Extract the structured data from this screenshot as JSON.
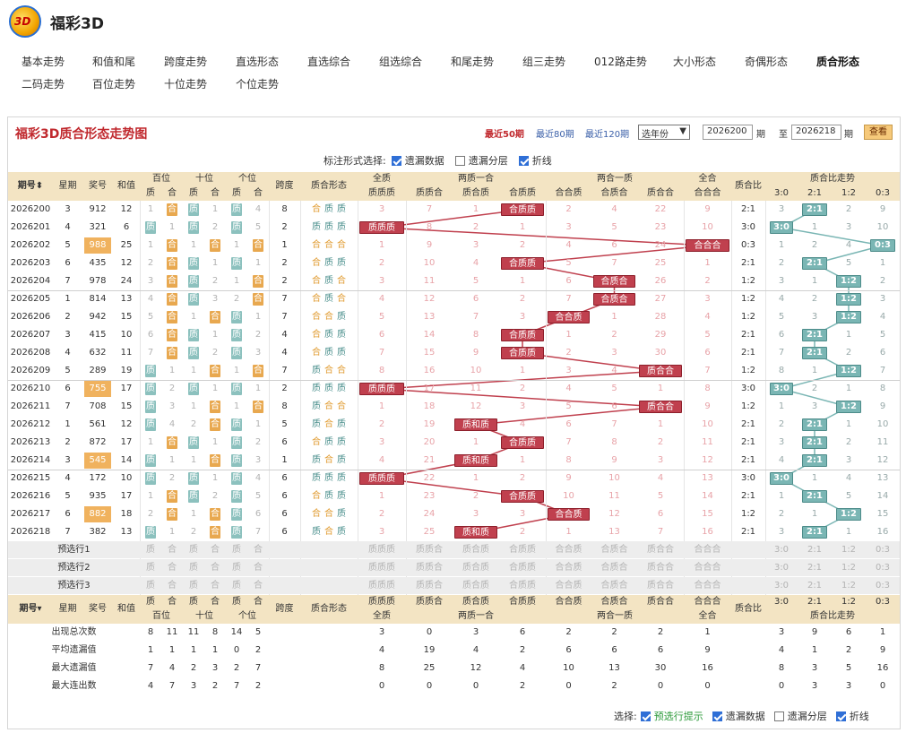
{
  "app": {
    "title": "福彩3D",
    "logo_text": "3D"
  },
  "nav": [
    "基本走势",
    "和值和尾",
    "跨度走势",
    "直选形态",
    "直选综合",
    "组选综合",
    "和尾走势",
    "组三走势",
    "012路走势",
    "大小形态",
    "奇偶形态",
    "质合形态",
    "二码走势",
    "百位走势",
    "十位走势",
    "个位走势"
  ],
  "nav_active": "质合形态",
  "panel": {
    "title": "福彩3D质合形态走势图",
    "ranges": [
      "最近50期",
      "最近80期",
      "最近120期"
    ],
    "year_select": "选年份",
    "from": "2026200",
    "to": "2026218",
    "period_unit": "期",
    "to_word": "至",
    "view_button": "查看",
    "mark_label": "标注形式选择:",
    "mark_opts": [
      {
        "label": "遗漏数据",
        "on": true
      },
      {
        "label": "遗漏分层",
        "on": false
      },
      {
        "label": "折线",
        "on": true
      }
    ]
  },
  "headers": {
    "period": "期号",
    "week": "星期",
    "number": "奖号",
    "sum": "和值",
    "pos": [
      "百位",
      "十位",
      "个位"
    ],
    "span": "跨度",
    "shape": "质合形态",
    "zh": [
      "质",
      "合"
    ],
    "groups": [
      "全质",
      "两质一合",
      "两合一质",
      "全合"
    ],
    "sub": [
      "质质质",
      "质质合",
      "质合质",
      "合质质",
      "合合质",
      "合质合",
      "质合合",
      "合合合"
    ],
    "ratio": "质合比",
    "trend": "质合比走势",
    "trend_cols": [
      "3:0",
      "2:1",
      "1:2",
      "0:3"
    ]
  },
  "rows": [
    {
      "p": "2026200",
      "w": "3",
      "n": "912",
      "s": "12",
      "hl": false,
      "pos": [
        "1",
        "合",
        "质",
        "1",
        "质",
        "4"
      ],
      "span": "8",
      "shape": "合质质",
      "sub": [
        "3",
        "7",
        "1",
        "合质质",
        "2",
        "4",
        "22",
        "9"
      ],
      "ratio": "2:1",
      "tr": [
        "3",
        "2:1",
        "2",
        "9"
      ]
    },
    {
      "p": "2026201",
      "w": "4",
      "n": "321",
      "s": "6",
      "hl": false,
      "pos": [
        "质",
        "1",
        "质",
        "2",
        "质",
        "5"
      ],
      "span": "2",
      "shape": "质质质",
      "sub": [
        "质质质",
        "8",
        "2",
        "1",
        "3",
        "5",
        "23",
        "10"
      ],
      "ratio": "3:0",
      "tr": [
        "3:0",
        "1",
        "3",
        "10"
      ]
    },
    {
      "p": "2026202",
      "w": "5",
      "n": "988",
      "s": "25",
      "hl": true,
      "pos": [
        "1",
        "合",
        "1",
        "合",
        "1",
        "合"
      ],
      "span": "1",
      "shape": "合合合",
      "sub": [
        "1",
        "9",
        "3",
        "2",
        "4",
        "6",
        "24",
        "合合合"
      ],
      "ratio": "0:3",
      "tr": [
        "1",
        "2",
        "4",
        "0:3"
      ]
    },
    {
      "p": "2026203",
      "w": "6",
      "n": "435",
      "s": "12",
      "hl": false,
      "pos": [
        "2",
        "合",
        "质",
        "1",
        "质",
        "1"
      ],
      "span": "2",
      "shape": "合质质",
      "sub": [
        "2",
        "10",
        "4",
        "合质质",
        "5",
        "7",
        "25",
        "1"
      ],
      "ratio": "2:1",
      "tr": [
        "2",
        "2:1",
        "5",
        "1"
      ]
    },
    {
      "p": "2026204",
      "w": "7",
      "n": "978",
      "s": "24",
      "hl": false,
      "pos": [
        "3",
        "合",
        "质",
        "2",
        "1",
        "合"
      ],
      "span": "2",
      "shape": "合质合",
      "sub": [
        "3",
        "11",
        "5",
        "1",
        "6",
        "合质合",
        "26",
        "2"
      ],
      "ratio": "1:2",
      "tr": [
        "3",
        "1",
        "1:2",
        "2"
      ]
    },
    {
      "p": "2026205",
      "w": "1",
      "n": "814",
      "s": "13",
      "hl": false,
      "pos": [
        "4",
        "合",
        "质",
        "3",
        "2",
        "合"
      ],
      "span": "7",
      "shape": "合质合",
      "sub": [
        "4",
        "12",
        "6",
        "2",
        "7",
        "合质合",
        "27",
        "3"
      ],
      "ratio": "1:2",
      "tr": [
        "4",
        "2",
        "1:2",
        "3"
      ]
    },
    {
      "p": "2026206",
      "w": "2",
      "n": "942",
      "s": "15",
      "hl": false,
      "pos": [
        "5",
        "合",
        "1",
        "合",
        "质",
        "1"
      ],
      "span": "7",
      "shape": "合合质",
      "sub": [
        "5",
        "13",
        "7",
        "3",
        "合合质",
        "1",
        "28",
        "4"
      ],
      "ratio": "1:2",
      "tr": [
        "5",
        "3",
        "1:2",
        "4"
      ]
    },
    {
      "p": "2026207",
      "w": "3",
      "n": "415",
      "s": "10",
      "hl": false,
      "pos": [
        "6",
        "合",
        "质",
        "1",
        "质",
        "2"
      ],
      "span": "4",
      "shape": "合质质",
      "sub": [
        "6",
        "14",
        "8",
        "合质质",
        "1",
        "2",
        "29",
        "5"
      ],
      "ratio": "2:1",
      "tr": [
        "6",
        "2:1",
        "1",
        "5"
      ]
    },
    {
      "p": "2026208",
      "w": "4",
      "n": "632",
      "s": "11",
      "hl": false,
      "pos": [
        "7",
        "合",
        "质",
        "2",
        "质",
        "3"
      ],
      "span": "4",
      "shape": "合质质",
      "sub": [
        "7",
        "15",
        "9",
        "合质质",
        "2",
        "3",
        "30",
        "6"
      ],
      "ratio": "2:1",
      "tr": [
        "7",
        "2:1",
        "2",
        "6"
      ]
    },
    {
      "p": "2026209",
      "w": "5",
      "n": "289",
      "s": "19",
      "hl": false,
      "pos": [
        "质",
        "1",
        "1",
        "合",
        "1",
        "合"
      ],
      "span": "7",
      "shape": "质合合",
      "sub": [
        "8",
        "16",
        "10",
        "1",
        "3",
        "4",
        "质合合",
        "7"
      ],
      "ratio": "1:2",
      "tr": [
        "8",
        "1",
        "1:2",
        "7"
      ]
    },
    {
      "p": "2026210",
      "w": "6",
      "n": "755",
      "s": "17",
      "hl": true,
      "pos": [
        "质",
        "2",
        "质",
        "1",
        "质",
        "1"
      ],
      "span": "2",
      "shape": "质质质",
      "sub": [
        "质质质",
        "17",
        "11",
        "2",
        "4",
        "5",
        "1",
        "8"
      ],
      "ratio": "3:0",
      "tr": [
        "3:0",
        "2",
        "1",
        "8"
      ]
    },
    {
      "p": "2026211",
      "w": "7",
      "n": "708",
      "s": "15",
      "hl": false,
      "pos": [
        "质",
        "3",
        "1",
        "合",
        "1",
        "合"
      ],
      "span": "8",
      "shape": "质合合",
      "sub": [
        "1",
        "18",
        "12",
        "3",
        "5",
        "6",
        "质合合",
        "9"
      ],
      "ratio": "1:2",
      "tr": [
        "1",
        "3",
        "1:2",
        "9"
      ]
    },
    {
      "p": "2026212",
      "w": "1",
      "n": "561",
      "s": "12",
      "hl": false,
      "pos": [
        "质",
        "4",
        "2",
        "合",
        "质",
        "1"
      ],
      "span": "5",
      "shape": "质合质",
      "sub": [
        "2",
        "19",
        "质和质",
        "4",
        "6",
        "7",
        "1",
        "10"
      ],
      "ratio": "2:1",
      "tr": [
        "2",
        "2:1",
        "1",
        "10"
      ]
    },
    {
      "p": "2026213",
      "w": "2",
      "n": "872",
      "s": "17",
      "hl": false,
      "pos": [
        "1",
        "合",
        "质",
        "1",
        "质",
        "2"
      ],
      "span": "6",
      "shape": "合质质",
      "sub": [
        "3",
        "20",
        "1",
        "合质质",
        "7",
        "8",
        "2",
        "11"
      ],
      "ratio": "2:1",
      "tr": [
        "3",
        "2:1",
        "2",
        "11"
      ]
    },
    {
      "p": "2026214",
      "w": "3",
      "n": "545",
      "s": "14",
      "hl": true,
      "pos": [
        "质",
        "1",
        "1",
        "合",
        "质",
        "3"
      ],
      "span": "1",
      "shape": "质合质",
      "sub": [
        "4",
        "21",
        "质和质",
        "1",
        "8",
        "9",
        "3",
        "12"
      ],
      "ratio": "2:1",
      "tr": [
        "4",
        "2:1",
        "3",
        "12"
      ]
    },
    {
      "p": "2026215",
      "w": "4",
      "n": "172",
      "s": "10",
      "hl": false,
      "pos": [
        "质",
        "2",
        "质",
        "1",
        "质",
        "4"
      ],
      "span": "6",
      "shape": "质质质",
      "sub": [
        "质质质",
        "22",
        "1",
        "2",
        "9",
        "10",
        "4",
        "13"
      ],
      "ratio": "3:0",
      "tr": [
        "3:0",
        "1",
        "4",
        "13"
      ]
    },
    {
      "p": "2026216",
      "w": "5",
      "n": "935",
      "s": "17",
      "hl": false,
      "pos": [
        "1",
        "合",
        "质",
        "2",
        "质",
        "5"
      ],
      "span": "6",
      "shape": "合质质",
      "sub": [
        "1",
        "23",
        "2",
        "合质质",
        "10",
        "11",
        "5",
        "14"
      ],
      "ratio": "2:1",
      "tr": [
        "1",
        "2:1",
        "5",
        "14"
      ]
    },
    {
      "p": "2026217",
      "w": "6",
      "n": "882",
      "s": "18",
      "hl": true,
      "pos": [
        "2",
        "合",
        "1",
        "合",
        "质",
        "6"
      ],
      "span": "6",
      "shape": "合合质",
      "sub": [
        "2",
        "24",
        "3",
        "3",
        "合合质",
        "12",
        "6",
        "15"
      ],
      "ratio": "1:2",
      "tr": [
        "2",
        "1",
        "1:2",
        "15"
      ]
    },
    {
      "p": "2026218",
      "w": "7",
      "n": "382",
      "s": "13",
      "hl": false,
      "pos": [
        "质",
        "1",
        "2",
        "合",
        "质",
        "7"
      ],
      "span": "6",
      "shape": "质合质",
      "sub": [
        "3",
        "25",
        "质和质",
        "2",
        "1",
        "13",
        "7",
        "16"
      ],
      "ratio": "2:1",
      "tr": [
        "3",
        "2:1",
        "1",
        "16"
      ]
    }
  ],
  "pre_rows": [
    "预选行1",
    "预选行2",
    "预选行3"
  ],
  "stats": [
    {
      "label": "出现总次数",
      "pos": [
        "8",
        "11",
        "11",
        "8",
        "14",
        "5"
      ],
      "sub": [
        "3",
        "0",
        "3",
        "6",
        "2",
        "2",
        "2",
        "1"
      ],
      "tr": [
        "3",
        "9",
        "6",
        "1"
      ]
    },
    {
      "label": "平均遗漏值",
      "pos": [
        "1",
        "1",
        "1",
        "1",
        "0",
        "2"
      ],
      "sub": [
        "4",
        "19",
        "4",
        "2",
        "6",
        "6",
        "6",
        "9"
      ],
      "tr": [
        "4",
        "1",
        "2",
        "9"
      ]
    },
    {
      "label": "最大遗漏值",
      "pos": [
        "7",
        "4",
        "2",
        "3",
        "2",
        "7"
      ],
      "sub": [
        "8",
        "25",
        "12",
        "4",
        "10",
        "13",
        "30",
        "16"
      ],
      "tr": [
        "8",
        "3",
        "5",
        "16"
      ]
    },
    {
      "label": "最大连出数",
      "pos": [
        "4",
        "7",
        "3",
        "2",
        "7",
        "2"
      ],
      "sub": [
        "0",
        "0",
        "0",
        "2",
        "0",
        "2",
        "0",
        "0"
      ],
      "tr": [
        "0",
        "3",
        "3",
        "0"
      ]
    }
  ],
  "footer": {
    "label": "选择:",
    "opts": [
      {
        "label": "预选行提示",
        "on": true,
        "green": true
      },
      {
        "label": "遗漏数据",
        "on": true
      },
      {
        "label": "遗漏分层",
        "on": false
      },
      {
        "label": "折线",
        "on": true
      }
    ]
  },
  "colors": {
    "accent": "#c0282d",
    "header_bg": "#f3e4c3",
    "orange": "#e8a84f",
    "teal": "#8cc1be",
    "red_line": "#c0404e",
    "blue_line": "#7ab6b4",
    "link": "#3a5fa8"
  }
}
